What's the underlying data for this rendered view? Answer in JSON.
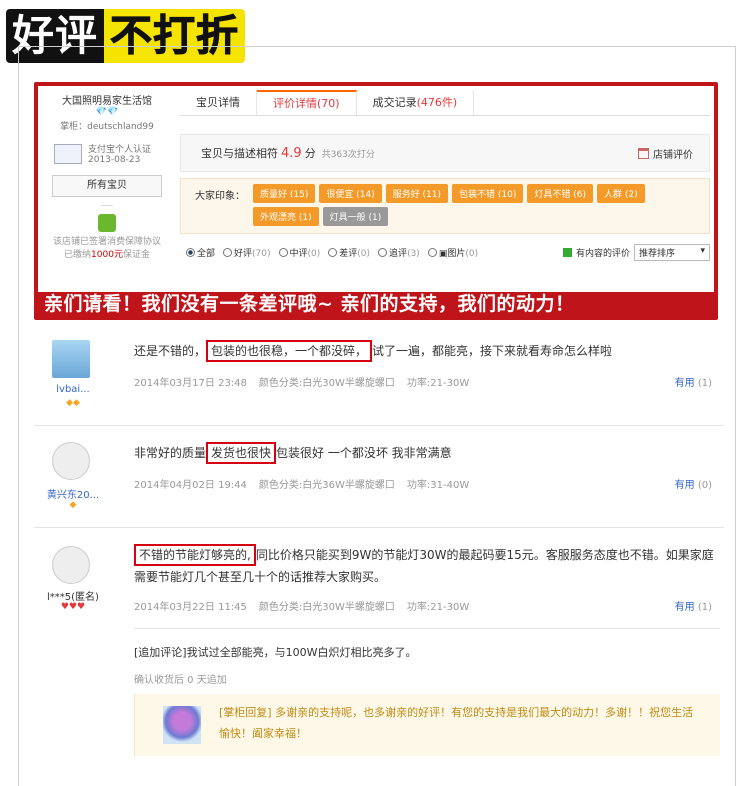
{
  "banner": {
    "part1": "好评",
    "part2": "不打折"
  },
  "shop": {
    "name": "大国照明易家生活馆",
    "diamonds": "💎💎",
    "owner": "掌柜：deutschland99",
    "cert_line1": "支付宝个人认证",
    "cert_line2": "2013-08-23",
    "all_items": "所有宝贝",
    "guarantee_l1": "该店铺已签署消费保障协议",
    "guarantee_l2a": "已缴纳",
    "guarantee_amount": "1000元",
    "guarantee_l2b": "保证金"
  },
  "tabs": [
    {
      "label": "宝贝详情",
      "count": ""
    },
    {
      "label": "评价详情",
      "count": "(70)"
    },
    {
      "label": "成交记录",
      "count": "(476件)"
    }
  ],
  "rating": {
    "label": "宝贝与描述相符",
    "score": "4.9",
    "unit": "分",
    "total": "共363次打分",
    "shop_rating": "店铺评价"
  },
  "impressions": {
    "label": "大家印象：",
    "tags": [
      "质量好 (15)",
      "很便宜 (14)",
      "服务好 (11)",
      "包装不错 (10)",
      "灯具不错 (6)",
      "人群 (2)",
      "外观漂亮 (1)",
      "灯具一般 (1)"
    ]
  },
  "filters": {
    "all": "全部",
    "good": "好评",
    "good_n": "(70)",
    "mid": "中评",
    "mid_n": "(0)",
    "bad": "差评",
    "bad_n": "(0)",
    "append": "追评",
    "append_n": "(3)",
    "pic": "图片",
    "pic_n": "(0)",
    "has_content": "有内容的评价",
    "sort": "推荐排序"
  },
  "strip": "亲们请看！我们没有一条差评哦~ 亲们的支持，我们的动力！",
  "reviews": [
    {
      "user": "lvbai...",
      "hearts": "◆◆",
      "text_a": "还是不错的，",
      "text_box": "包装的也很稳，一个都没碎，",
      "text_b": "试了一遍，都能亮，接下来就看寿命怎么样啦",
      "date": "2014年03月17日 23:48",
      "color": "颜色分类:白光30W半螺旋螺口",
      "power": "功率:21-30W",
      "useful": "有用",
      "useful_n": "(1)"
    },
    {
      "user": "黄兴东20...",
      "hearts": "◆",
      "text_a": "非常好的质量",
      "text_box": "发货也很快",
      "text_b": "包装很好 一个都没坏 我非常满意",
      "date": "2014年04月02日 19:44",
      "color": "颜色分类:白光36W半螺旋螺口",
      "power": "功率:31-40W",
      "useful": "有用",
      "useful_n": "(0)"
    },
    {
      "user": "l***5(匿名)",
      "hearts": "♥♥♥",
      "text_box": "不错的节能灯够亮的,",
      "text_b": "同比价格只能买到9W的节能灯30W的最起码要15元。客服服务态度也不错。如果家庭需要节能灯几个甚至几十个的话推荐大家购买。",
      "date": "2014年03月22日 11:45",
      "color": "颜色分类:白光30W半螺旋螺口",
      "power": "功率:21-30W",
      "useful": "有用",
      "useful_n": "(1)",
      "append": "[追加评论]我试过全部能亮，与100W白炽灯相比亮多了。",
      "append_meta": "确认收货后 0 天追加",
      "reply": "[掌柜回复] 多谢亲的支持呢，也多谢亲的好评！有您的支持是我们最大的动力！多谢！！祝您生活愉快！阖家幸福！"
    }
  ]
}
